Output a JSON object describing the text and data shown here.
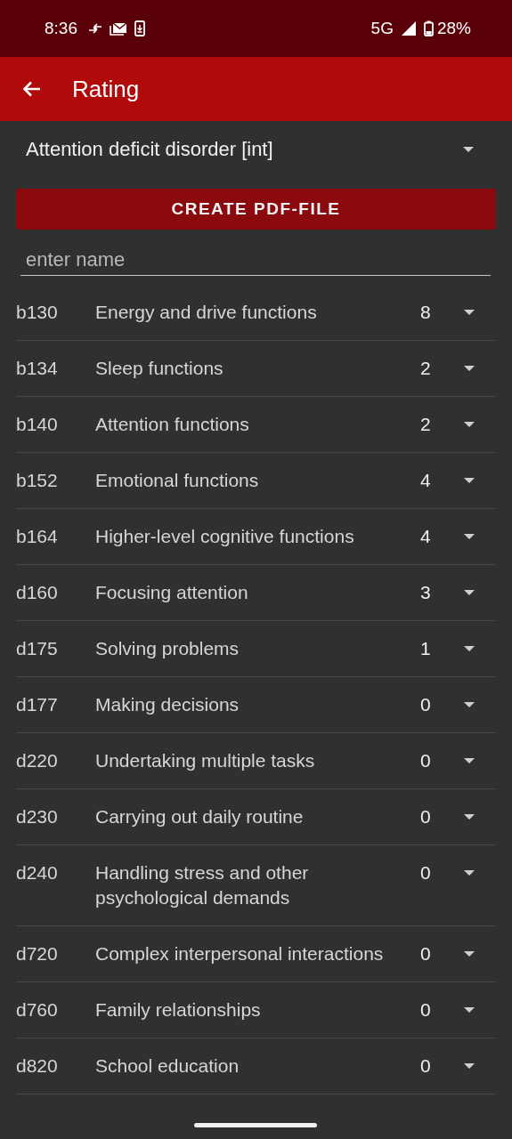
{
  "status_bar": {
    "time": "8:36",
    "network": "5G",
    "battery": "28%"
  },
  "app_bar": {
    "title": "Rating"
  },
  "disorder_select": {
    "value": "Attention deficit disorder [int]"
  },
  "create_button": {
    "label": "CREATE PDF-FILE"
  },
  "name_field": {
    "placeholder": "enter name"
  },
  "items": [
    {
      "code": "b130",
      "name": "Energy and drive functions",
      "value": "8"
    },
    {
      "code": "b134",
      "name": "Sleep functions",
      "value": "2"
    },
    {
      "code": "b140",
      "name": "Attention functions",
      "value": "2"
    },
    {
      "code": "b152",
      "name": "Emotional functions",
      "value": "4"
    },
    {
      "code": "b164",
      "name": "Higher-level cognitive functions",
      "value": "4"
    },
    {
      "code": "d160",
      "name": "Focusing attention",
      "value": "3"
    },
    {
      "code": "d175",
      "name": "Solving problems",
      "value": "1"
    },
    {
      "code": "d177",
      "name": "Making decisions",
      "value": "0"
    },
    {
      "code": "d220",
      "name": "Undertaking multiple tasks",
      "value": "0"
    },
    {
      "code": "d230",
      "name": "Carrying out daily routine",
      "value": "0"
    },
    {
      "code": "d240",
      "name": "Handling stress and other psychological demands",
      "value": "0"
    },
    {
      "code": "d720",
      "name": "Complex interpersonal interactions",
      "value": "0"
    },
    {
      "code": "d760",
      "name": "Family relationships",
      "value": "0"
    },
    {
      "code": "d820",
      "name": "School education",
      "value": "0"
    }
  ]
}
